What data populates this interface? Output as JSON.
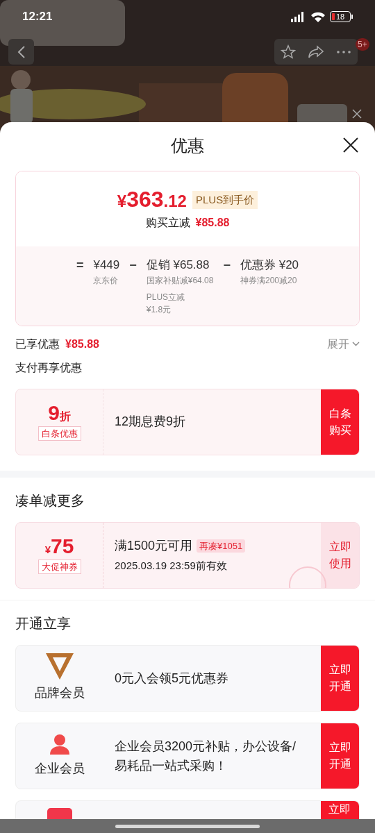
{
  "status_bar": {
    "time": "12:21",
    "battery": "18"
  },
  "nav": {
    "badge": "5+"
  },
  "sheet": {
    "title": "优惠"
  },
  "price_card": {
    "currency": "¥",
    "integer": "363",
    "decimal": ".12",
    "tag": "PLUS到手价",
    "saving_label": "购买立减",
    "saving_value": "¥85.88",
    "formula": [
      {
        "op": "=",
        "value": "¥449",
        "notes": [
          "京东价"
        ]
      },
      {
        "op": "−",
        "value": "促销 ¥65.88",
        "notes": [
          "国家补贴减¥64.08",
          "PLUS立减\n¥1.8元"
        ]
      },
      {
        "op": "−",
        "value": "优惠券 ¥20",
        "notes": [
          "神券满200减20"
        ]
      }
    ]
  },
  "enjoyed": {
    "label": "已享优惠",
    "value": "¥85.88",
    "expand": "展开"
  },
  "pay_section": {
    "title": "支付再享优惠",
    "offers": [
      {
        "big": "9",
        "unit": "折",
        "tag": "白条优惠",
        "text": "12期息费9折",
        "button": "白条购买"
      }
    ]
  },
  "bundle_section": {
    "title": "凑单减更多",
    "coupons": [
      {
        "currency": "¥",
        "amount": "75",
        "tag": "大促神券",
        "condition": "满1500元可用",
        "extra": "再凑¥1051",
        "validity": "2025.03.19 23:59前有效",
        "button": "立即使用",
        "received": true
      }
    ]
  },
  "join_section": {
    "title": "开通立享",
    "items": [
      {
        "kind": "brand",
        "name": "品牌会员",
        "text": "0元入会领5元优惠券",
        "button": "立即开通"
      },
      {
        "kind": "enterprise",
        "name": "企业会员",
        "text": "企业会员3200元补贴，办公设备/易耗品一站式采购！",
        "button": "立即开通"
      },
      {
        "kind": "app",
        "button": "立即"
      }
    ]
  }
}
